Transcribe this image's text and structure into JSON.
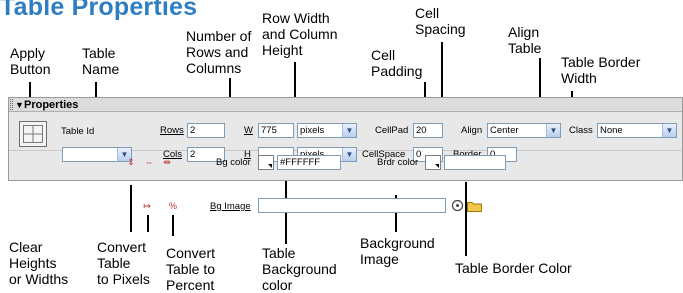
{
  "page_title": "Table Properties",
  "callouts": {
    "apply_button": "Apply\nButton",
    "table_name": "Table\nName",
    "rows_cols": "Number of\nRows and\nColumns",
    "row_width_height": "Row Width\nand Column\nHeight",
    "cell_padding": "Cell\nPadding",
    "cell_spacing": "Cell\nSpacing",
    "align_table": "Align\nTable",
    "table_border_width": "Table Border\nWidth",
    "clear_heights": "Clear\nHeights\nor Widths",
    "convert_pixels": "Convert\nTable\nto Pixels",
    "convert_percent": "Convert\nTable to\nPercent",
    "table_bg_color": "Table\nBackground\ncolor",
    "bg_image": "Background\nImage",
    "border_color": "Table Border Color"
  },
  "panel": {
    "title": "Properties",
    "table_id_label": "Table Id",
    "table_id_value": "",
    "rows_label": "Rows",
    "rows_value": "2",
    "cols_label": "Cols",
    "cols_value": "2",
    "w_label": "W",
    "w_value": "775",
    "w_unit": "pixels",
    "h_label": "H",
    "h_value": "",
    "h_unit": "pixels",
    "cellpad_label": "CellPad",
    "cellpad_value": "20",
    "cellspace_label": "CellSpace",
    "cellspace_value": "0",
    "align_label": "Align",
    "align_value": "Center",
    "border_label": "Border",
    "border_value": "0",
    "class_label": "Class",
    "class_value": "None",
    "bg_color_label": "Bg color",
    "bg_color_value": "#FFFFFF",
    "brdr_color_label": "Brdr color",
    "brdr_color_value": "",
    "bg_image_label": "Bg Image",
    "bg_image_value": ""
  },
  "colors": {
    "title": "#2e7ec1",
    "panel_bg": "#e8e8e8",
    "callout_line": "#000000"
  },
  "icons": [
    "properties-expand-icon",
    "table-icon",
    "clear-heights-icon",
    "clear-widths-icon",
    "convert-pixels-icon",
    "convert-percent-icon",
    "point-to-file-icon",
    "browse-folder-icon"
  ]
}
